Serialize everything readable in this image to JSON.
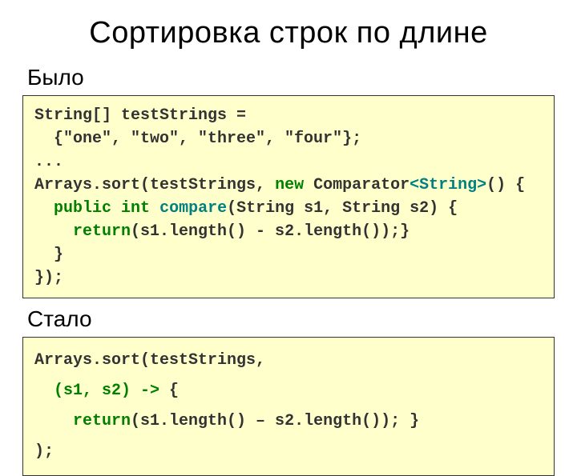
{
  "title": "Сортировка строк по длине",
  "labels": {
    "before": "Было",
    "after": "Стало"
  },
  "code_before": {
    "l1": "String[] testStrings =",
    "l2": "  {\"one\", \"two\", \"three\", \"four\"};",
    "l3": "...",
    "l4a": "Arrays.sort(testStrings, ",
    "l4_new": "new",
    "l4b": " Comparator",
    "l4_tpl": "<String>",
    "l4c": "() {",
    "l5a": "  ",
    "l5_pub": "public int",
    "l5b": " ",
    "l5_cmp": "compare",
    "l5c": "(String s1, String s2) {",
    "l6a": "    ",
    "l6_ret": "return",
    "l6b": "(s1.length() - s2.length());}",
    "l7": "  }",
    "l8": "});"
  },
  "code_after": {
    "l1": "Arrays.sort(testStrings,",
    "l2a": "  ",
    "l2_lam": "(s1, s2) ->",
    "l2b": " {",
    "l3a": "    ",
    "l3_ret": "return",
    "l3b": "(s1.length() – s2.length()); }",
    "l4": ");"
  }
}
